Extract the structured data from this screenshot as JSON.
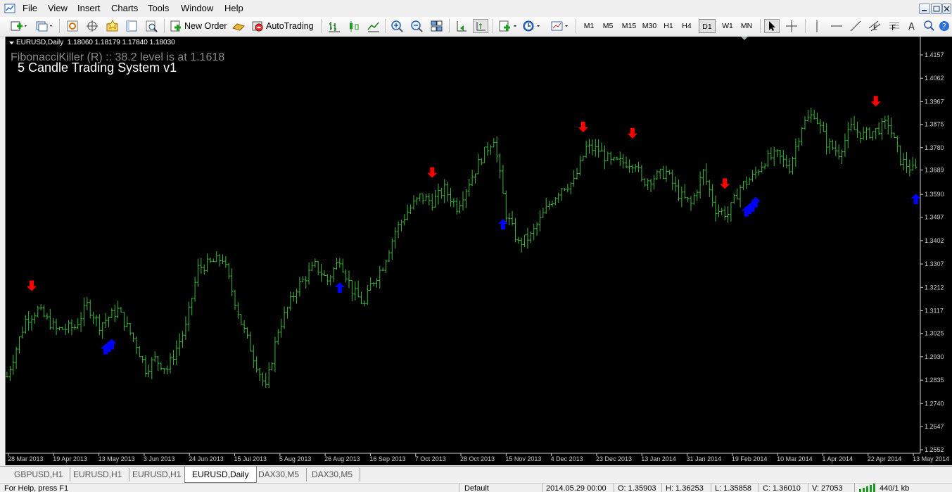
{
  "menu": [
    "File",
    "View",
    "Insert",
    "Charts",
    "Tools",
    "Window",
    "Help"
  ],
  "toolbar": {
    "new_order": "New Order",
    "auto_trading": "AutoTrading",
    "timeframes": [
      "M1",
      "M5",
      "M15",
      "M30",
      "H1",
      "H4",
      "D1",
      "W1",
      "MN"
    ],
    "active_timeframe": "D1"
  },
  "chart": {
    "symbol_header": "EURUSD,Daily  1.18060 1.18179 1.17840 1.18030",
    "indicator_text": "FibonacciKiller (R) :: 38.2 level is at 1.1618",
    "system_title": "5 Candle Trading System v1",
    "colors": {
      "background": "#000000",
      "bars": "#3db83d",
      "up_arrow": "#0000ff",
      "down_arrow": "#ff0000",
      "axis_text": "#cfcfcf"
    }
  },
  "chart_data": {
    "type": "bar",
    "title": "EURUSD,Daily",
    "y_ticks": [
      "1.4157",
      "1.4062",
      "1.3967",
      "1.3875",
      "1.3780",
      "1.3689",
      "1.3590",
      "1.3497",
      "1.3402",
      "1.3307",
      "1.3212",
      "1.3117",
      "1.3025",
      "1.2930",
      "1.2835",
      "1.2740",
      "1.2647",
      "1.2552"
    ],
    "ylim": [
      1.2552,
      1.4157
    ],
    "x_ticks": [
      "28 Mar 2013",
      "19 Apr 2013",
      "13 May 2013",
      "3 Jun 2013",
      "24 Jun 2013",
      "15 Jul 2013",
      "5 Aug 2013",
      "26 Aug 2013",
      "16 Sep 2013",
      "7 Oct 2013",
      "28 Oct 2013",
      "15 Nov 2013",
      "4 Dec 2013",
      "23 Dec 2013",
      "13 Jan 2014",
      "31 Jan 2014",
      "19 Feb 2014",
      "10 Mar 2014",
      "1 Apr 2014",
      "22 Apr 2014",
      "13 May 2014"
    ],
    "close_path": {
      "x_index": [
        0,
        6,
        10,
        16,
        22,
        26,
        30,
        36,
        42,
        45,
        48,
        52,
        58,
        62,
        70,
        76,
        80,
        84,
        88,
        94,
        100,
        104,
        108,
        112,
        116,
        118,
        122,
        126,
        130,
        134,
        138,
        142,
        146,
        150,
        154,
        158,
        162,
        166,
        170,
        176,
        180,
        184,
        188,
        192,
        196,
        200,
        204,
        206,
        210,
        214,
        218,
        222,
        226,
        230,
        234,
        238,
        242,
        246,
        250,
        254,
        258,
        262,
        266,
        270,
        274,
        278,
        282,
        286,
        290,
        294
      ],
      "close": [
        1.285,
        1.308,
        1.312,
        1.304,
        1.305,
        1.314,
        1.306,
        1.312,
        1.298,
        1.288,
        1.292,
        1.288,
        1.305,
        1.329,
        1.333,
        1.307,
        1.293,
        1.28,
        1.304,
        1.321,
        1.33,
        1.324,
        1.333,
        1.32,
        1.314,
        1.322,
        1.33,
        1.344,
        1.352,
        1.358,
        1.356,
        1.361,
        1.354,
        1.364,
        1.374,
        1.382,
        1.351,
        1.339,
        1.342,
        1.355,
        1.362,
        1.364,
        1.378,
        1.377,
        1.372,
        1.372,
        1.372,
        1.364,
        1.366,
        1.368,
        1.359,
        1.355,
        1.368,
        1.353,
        1.351,
        1.362,
        1.366,
        1.373,
        1.375,
        1.37,
        1.387,
        1.392,
        1.38,
        1.376,
        1.386,
        1.383,
        1.385,
        1.388,
        1.373,
        1.369
      ],
      "total_bars": 296
    },
    "signals": {
      "up_bar_index": [
        32,
        33,
        34,
        108,
        161,
        240,
        241,
        242,
        243,
        298
      ],
      "down_bar_index": [
        8,
        138,
        187,
        203,
        233,
        282
      ]
    },
    "grid": false
  },
  "tabs": [
    "GBPUSD,H1",
    "EURUSD,H1",
    "EURUSD,H1",
    "EURUSD,Daily",
    "DAX30,M5",
    "DAX30,M5"
  ],
  "active_tab": "EURUSD,Daily",
  "status": {
    "help": "For Help, press F1",
    "profile": "Default",
    "datetime": "2014.05.29 00:00",
    "open": "O: 1.35903",
    "high": "H: 1.36253",
    "low": "L: 1.35858",
    "close": "C: 1.36010",
    "volume": "V: 27053",
    "traffic": "440/1 kb"
  }
}
